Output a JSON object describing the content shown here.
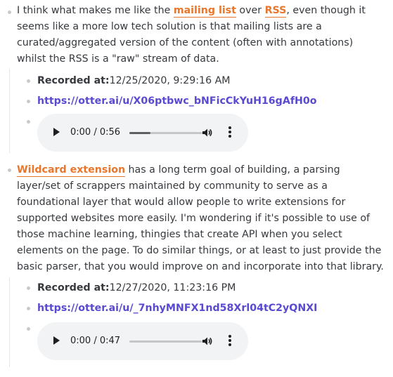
{
  "note1": {
    "text_before": "I think what makes me like the ",
    "ref1": "mailing list",
    "text_mid": " over ",
    "ref2": "RSS",
    "text_after": ", even though it seems like a more low tech solution is that mailing lists are a curated/aggregated version of the content (often with annotations) whilst the RSS is a \"raw\" stream of data.",
    "recorded_label": "Recorded at:",
    "recorded_value": "12/25/2020, 9:29:16 AM",
    "link": "https://otter.ai/u/X06ptbwc_bNFicCkYuH16gAfH0o",
    "audio": {
      "time": "0:00 / 0:56",
      "progress": 0
    }
  },
  "note2": {
    "ref": "Wildcard extension",
    "text_after": " has a long term goal of building, a parsing layer/set of scrappers maintained by community to serve as a foundational layer that would allow people to write extensions for supported websites more easily. I'm wondering if it's possible to use of those machine learning, thingies that create API when you select elements on the page. To do similar things, or at least to just provide the basic parser, that you would improve on and incorporate into that library.",
    "recorded_label": "Recorded at:",
    "recorded_value": "12/27/2020, 11:23:16 PM",
    "link": "https://otter.ai/u/_7nhyMNFX1nd58Xrl04tC2yQNXI",
    "audio": {
      "time": "0:00 / 0:47",
      "progress": 0
    }
  },
  "colors": {
    "reference": "#e8762b",
    "link": "#5a4ad1",
    "text": "#36393d",
    "audio_bg": "#f1f3f4"
  },
  "icons": [
    "play-icon",
    "volume-icon",
    "more-options-icon",
    "bullet"
  ]
}
